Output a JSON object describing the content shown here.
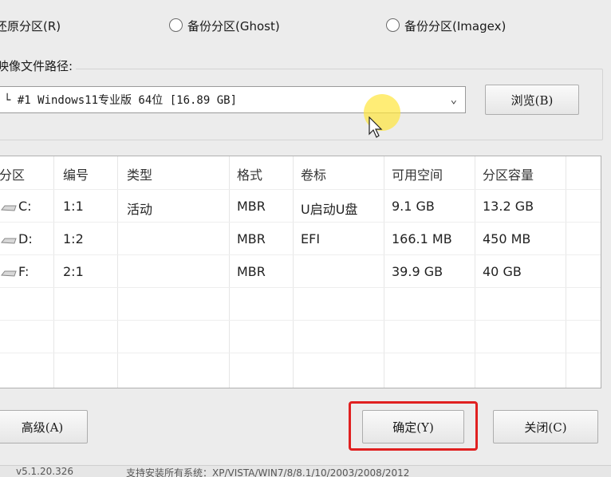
{
  "options": {
    "restore_label": "还原分区(R)",
    "backup_ghost_label": "备份分区(Ghost)",
    "backup_imagex_label": "备份分区(Imagex)"
  },
  "image_path": {
    "label": "映像文件路径:",
    "selected": "└ #1 Windows11专业版 64位 [16.89 GB]",
    "browse_label": "浏览(B)"
  },
  "table": {
    "columns": [
      "分区",
      "编号",
      "类型",
      "格式",
      "卷标",
      "可用空间",
      "分区容量"
    ],
    "rows": [
      {
        "partition": "C:",
        "number": "1:1",
        "type": "活动",
        "format": "MBR",
        "label": "U启动U盘",
        "free": "9.1 GB",
        "capacity": "13.2 GB"
      },
      {
        "partition": "D:",
        "number": "1:2",
        "type": "",
        "format": "MBR",
        "label": "EFI",
        "free": "166.1 MB",
        "capacity": "450 MB"
      },
      {
        "partition": "F:",
        "number": "2:1",
        "type": "",
        "format": "MBR",
        "label": "",
        "free": "39.9 GB",
        "capacity": "40 GB"
      }
    ]
  },
  "buttons": {
    "advanced_label": "高级(A)",
    "ok_label": "确定(Y)",
    "close_label": "关闭(C)"
  },
  "status": {
    "version": "v5.1.20.326",
    "message": "支持安装所有系统：XP/VISTA/WIN7/8/8.1/10/2003/2008/2012"
  }
}
